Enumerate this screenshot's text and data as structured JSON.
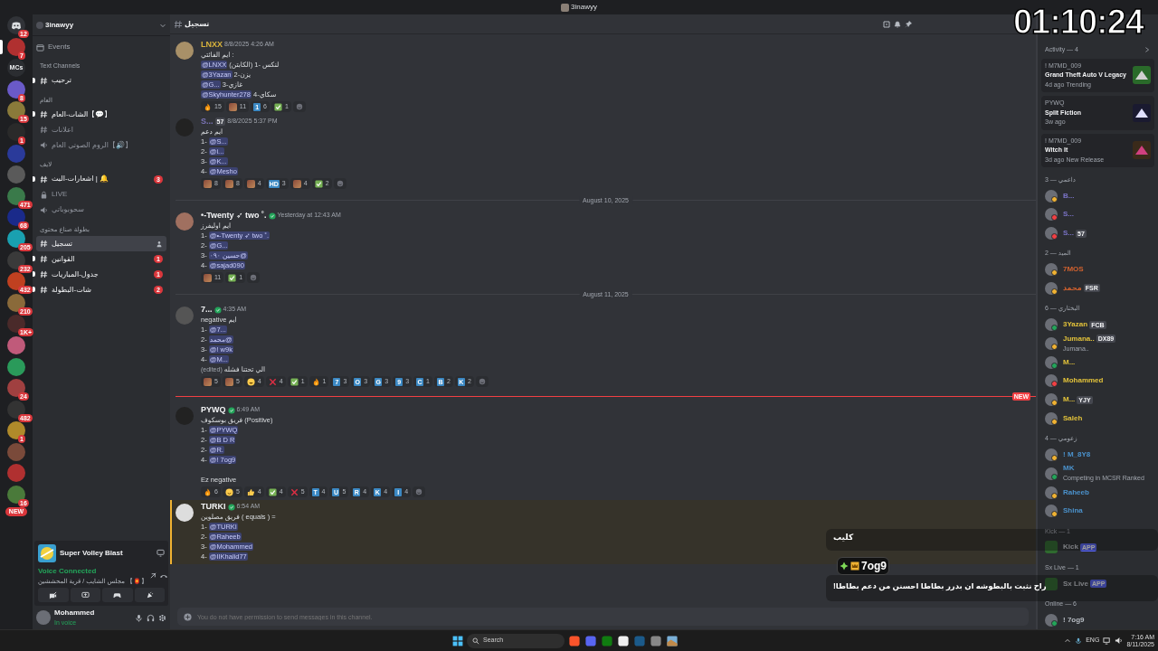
{
  "window": {
    "title": "3inawyy"
  },
  "timer_overlay": "01:10:24",
  "server_rail": [
    {
      "kind": "home",
      "badge": "12",
      "selected": false
    },
    {
      "kind": "server",
      "badge": "7",
      "selected": true
    },
    {
      "kind": "label",
      "label": "MCs",
      "selected": false
    },
    {
      "kind": "server",
      "badge": "8",
      "selected": false
    },
    {
      "kind": "server",
      "badge": "15",
      "selected": false
    },
    {
      "kind": "server",
      "badge": "1",
      "selected": false
    },
    {
      "kind": "server",
      "selected": false
    },
    {
      "kind": "server",
      "selected": false
    },
    {
      "kind": "server",
      "badge": "471",
      "selected": false
    },
    {
      "kind": "server",
      "badge": "68",
      "selected": false
    },
    {
      "kind": "server",
      "badge": "205",
      "selected": false
    },
    {
      "kind": "server",
      "badge": "232",
      "selected": false
    },
    {
      "kind": "server",
      "badge": "432",
      "selected": false
    },
    {
      "kind": "server",
      "badge": "210",
      "selected": false
    },
    {
      "kind": "server",
      "badge": "1K+",
      "selected": false
    },
    {
      "kind": "server",
      "selected": false
    },
    {
      "kind": "server",
      "selected": false
    },
    {
      "kind": "server",
      "badge": "24",
      "selected": false
    },
    {
      "kind": "server",
      "badge": "482",
      "selected": false
    },
    {
      "kind": "server",
      "badge": "1",
      "selected": false
    },
    {
      "kind": "server",
      "selected": false
    },
    {
      "kind": "server",
      "selected": false
    },
    {
      "kind": "server",
      "badge": "16",
      "selected": false
    }
  ],
  "new_pill": "NEW",
  "sidebar": {
    "server_name": "3inawyy",
    "events": "Events",
    "categories": [
      {
        "name": "Text Channels",
        "channels": [
          {
            "kind": "text",
            "name": "ترحيب",
            "unread": true,
            "selected": false
          }
        ]
      },
      {
        "name": "العام",
        "channels": [
          {
            "kind": "text",
            "name": "الشات-العام【💬】",
            "unread": true,
            "selected": false
          },
          {
            "kind": "text",
            "name": "اعلانات",
            "unread": false,
            "selected": false
          },
          {
            "kind": "voice",
            "name": "الروم الصوتي العام【🔊】",
            "unread": false,
            "selected": false
          }
        ]
      },
      {
        "name": "لايف",
        "channels": [
          {
            "kind": "text",
            "name": "اشعارات-البث | 🔔",
            "unread": true,
            "badge": "3",
            "selected": false
          },
          {
            "kind": "locked",
            "name": "LIVE",
            "unread": false,
            "selected": false
          },
          {
            "kind": "voice",
            "name": "سحوبوباتي",
            "unread": false,
            "selected": false
          }
        ]
      },
      {
        "name": "بطولة صناع محتوى",
        "channels": [
          {
            "kind": "text",
            "name": "تسجيل",
            "unread": false,
            "selected": true
          },
          {
            "kind": "text",
            "name": "القوانين",
            "unread": true,
            "badge": "1",
            "selected": false
          },
          {
            "kind": "text",
            "name": "جدول-المباريات",
            "unread": true,
            "badge": "1",
            "selected": false
          },
          {
            "kind": "text",
            "name": "شات-البطولة",
            "unread": true,
            "badge": "2",
            "selected": false
          }
        ]
      }
    ]
  },
  "activity_panel": {
    "game": "Super Volley Blast",
    "voice_status": "Voice Connected",
    "voice_channel": "مجلس الشايب / قرية المحششين 【🏮】"
  },
  "user_panel": {
    "name": "Mohammed",
    "status": "In voice"
  },
  "channel_header": {
    "name": "تسجيل"
  },
  "messages": [
    {
      "kind": "message",
      "author": "LNXX",
      "color": "#d9b43c",
      "time": "8/8/2025 4:26 AM",
      "verified": false,
      "highlighted": false,
      "lines": [
        [
          {
            "kind": "plain",
            "text": "ايم الفائتي :"
          }
        ],
        [
          {
            "kind": "mention",
            "text": "@LNXX"
          },
          {
            "kind": "plain",
            "text": " (الكابتن) لنكس -1"
          }
        ],
        [
          {
            "kind": "mention",
            "text": "@3Yazan"
          },
          {
            "kind": "plain",
            "text": " يزن-2"
          }
        ],
        [
          {
            "kind": "mention",
            "text": "@G..."
          },
          {
            "kind": "plain",
            "text": " غازي-3"
          }
        ],
        [
          {
            "kind": "mention",
            "text": "@Skyhunter278"
          },
          {
            "kind": "plain",
            "text": " سكاي-4"
          }
        ]
      ],
      "reactions": [
        {
          "kind": "fire",
          "count": "15"
        },
        {
          "count": "11"
        },
        {
          "kind": "letter",
          "label": "1",
          "count": "6"
        },
        {
          "kind": "check",
          "count": "1"
        }
      ]
    },
    {
      "kind": "message",
      "author": "S...",
      "color": "#7b74b8",
      "tag": "57",
      "time": "8/8/2025 5:37 PM",
      "verified": false,
      "highlighted": false,
      "lines": [
        [
          {
            "kind": "plain",
            "text": "ايم دعم"
          }
        ],
        [
          {
            "kind": "plain",
            "text": "1- "
          },
          {
            "kind": "mention",
            "text": "@S..."
          }
        ],
        [
          {
            "kind": "plain",
            "text": "2- "
          },
          {
            "kind": "mention",
            "text": "@i..."
          }
        ],
        [
          {
            "kind": "plain",
            "text": "3- "
          },
          {
            "kind": "mention",
            "text": "@K..."
          }
        ],
        [
          {
            "kind": "plain",
            "text": "4- "
          },
          {
            "kind": "mention",
            "text": "@Mesho"
          }
        ]
      ],
      "reactions": [
        {
          "count": "8"
        },
        {
          "count": "8"
        },
        {
          "count": "4"
        },
        {
          "kind": "letter",
          "label": "HD",
          "count": "3"
        },
        {
          "count": "4"
        },
        {
          "kind": "check",
          "count": "2"
        }
      ]
    },
    {
      "kind": "divider",
      "text": "August 10, 2025"
    },
    {
      "kind": "message",
      "author": "•-Twenty ➶ two ˚.",
      "color": "#f2f3f5",
      "time": "Yesterday at 12:43 AM",
      "verified": true,
      "highlighted": false,
      "lines": [
        [
          {
            "kind": "plain",
            "text": "ايم اوليفرز"
          }
        ],
        [
          {
            "kind": "plain",
            "text": "1- "
          },
          {
            "kind": "mention",
            "text": "@•-Twenty ➶ two ˚."
          }
        ],
        [
          {
            "kind": "plain",
            "text": "2- "
          },
          {
            "kind": "mention",
            "text": "@G..."
          }
        ],
        [
          {
            "kind": "plain",
            "text": "3- "
          },
          {
            "kind": "mention",
            "text": "@حسين ٠٩٠"
          }
        ],
        [
          {
            "kind": "plain",
            "text": "4- "
          },
          {
            "kind": "mention",
            "text": "@sajad090"
          }
        ]
      ],
      "reactions": [
        {
          "count": "11"
        },
        {
          "kind": "check",
          "count": "1"
        }
      ]
    },
    {
      "kind": "divider",
      "text": "August 11, 2025"
    },
    {
      "kind": "message",
      "author": "7...",
      "color": "#f2f3f5",
      "time": "4:35 AM",
      "verified": true,
      "highlighted": false,
      "lines": [
        [
          {
            "kind": "plain",
            "text": "negative ايم"
          }
        ],
        [
          {
            "kind": "plain",
            "text": "1- "
          },
          {
            "kind": "mention",
            "text": "@7..."
          }
        ],
        [
          {
            "kind": "plain",
            "text": "2- "
          },
          {
            "kind": "mention",
            "text": "@محمد"
          }
        ],
        [
          {
            "kind": "plain",
            "text": "3- "
          },
          {
            "kind": "mention",
            "text": "@! w9k"
          }
        ],
        [
          {
            "kind": "plain",
            "text": "4- "
          },
          {
            "kind": "mention",
            "text": "@M..."
          }
        ],
        [
          {
            "kind": "edited",
            "text": "(edited)"
          },
          {
            "kind": "plain",
            "text": " الي تحتنا فشله"
          }
        ]
      ],
      "reactions": [
        {
          "count": "5"
        },
        {
          "count": "5"
        },
        {
          "kind": "laugh",
          "count": "4"
        },
        {
          "kind": "cross",
          "count": "4"
        },
        {
          "kind": "check",
          "count": "1"
        },
        {
          "kind": "fire",
          "count": "1"
        },
        {
          "kind": "letter",
          "label": "7",
          "count": "3"
        },
        {
          "kind": "letter",
          "label": "O",
          "count": "3"
        },
        {
          "kind": "letter",
          "label": "G",
          "count": "3"
        },
        {
          "kind": "letter",
          "label": "9",
          "count": "3"
        },
        {
          "kind": "letter",
          "label": "C",
          "count": "1"
        },
        {
          "kind": "letter",
          "label": "B",
          "count": "2"
        },
        {
          "kind": "letter",
          "label": "K",
          "count": "2"
        }
      ]
    },
    {
      "kind": "new_divider",
      "text": "NEW"
    },
    {
      "kind": "message",
      "author": "PYWQ",
      "color": "#f2f3f5",
      "time": "6:49 AM",
      "verified": true,
      "highlighted": false,
      "lines": [
        [
          {
            "kind": "plain",
            "text": "فريق بوسكوف (Positive)"
          }
        ],
        [
          {
            "kind": "plain",
            "text": "1- "
          },
          {
            "kind": "mention",
            "text": "@PYWQ"
          }
        ],
        [
          {
            "kind": "plain",
            "text": "2- "
          },
          {
            "kind": "mention",
            "text": "@B D R"
          }
        ],
        [
          {
            "kind": "plain",
            "text": "2- "
          },
          {
            "kind": "mention",
            "text": "@R."
          }
        ],
        [
          {
            "kind": "plain",
            "text": "4- "
          },
          {
            "kind": "mention",
            "text": "@! 7og9"
          }
        ],
        [
          {
            "kind": "gap"
          },
          {
            "kind": "plain",
            "text": "Ez  negative"
          }
        ]
      ],
      "reactions": [
        {
          "kind": "fire",
          "count": "6"
        },
        {
          "kind": "smile",
          "count": "5"
        },
        {
          "kind": "thumbs",
          "count": "4"
        },
        {
          "kind": "check",
          "count": "4"
        },
        {
          "kind": "cross",
          "count": "5"
        },
        {
          "kind": "letter",
          "label": "T",
          "count": "4"
        },
        {
          "kind": "letter",
          "label": "U",
          "count": "5"
        },
        {
          "kind": "letter",
          "label": "R",
          "count": "4"
        },
        {
          "kind": "letter",
          "label": "K",
          "count": "4"
        },
        {
          "kind": "letter",
          "label": "I",
          "count": "4"
        }
      ]
    },
    {
      "kind": "message",
      "author": "TURKI",
      "color": "#f2f3f5",
      "time": "6:54 AM",
      "verified": true,
      "highlighted": true,
      "lines": [
        [
          {
            "kind": "plain",
            "text": "فريق مصلوين ( equals ) ="
          }
        ],
        [
          {
            "kind": "plain",
            "text": "1- "
          },
          {
            "kind": "mention",
            "text": "@TURKI"
          }
        ],
        [
          {
            "kind": "plain",
            "text": "2- "
          },
          {
            "kind": "mention",
            "text": "@Raheeb"
          }
        ],
        [
          {
            "kind": "plain",
            "text": "3- "
          },
          {
            "kind": "mention",
            "text": "@Mohammed"
          }
        ],
        [
          {
            "kind": "plain",
            "text": "4- "
          },
          {
            "kind": "mention",
            "text": "@IIKhalid77"
          }
        ]
      ]
    }
  ],
  "composer": {
    "placeholder": "You do not have permission to send messages in this channel."
  },
  "activity": {
    "title": "Activity — 4",
    "cards": [
      {
        "user": "! M7MD_009",
        "game": "Grand Theft Auto V Legacy",
        "ago": "4d ago",
        "note": "Trending"
      },
      {
        "user": "PYWQ",
        "game": "Split Fiction",
        "ago": "3w ago"
      },
      {
        "user": "! M7MD_009",
        "game": "Witch It",
        "ago": "3d ago",
        "note": "New Release"
      }
    ]
  },
  "member_groups": [
    {
      "title": "داعمي — 3",
      "color": "#7b74c8",
      "members": [
        {
          "name": "B...",
          "color": "#f0b232"
        },
        {
          "name": "S...",
          "color": "#f23f43"
        },
        {
          "name": "S...",
          "color": "#f23f43",
          "tag": "57"
        }
      ]
    },
    {
      "title": "الميد — 2",
      "color": "#d2622f",
      "members": [
        {
          "name": "7MOS",
          "color": "#f0b232"
        },
        {
          "name": "محمد",
          "color": "#f0b232",
          "tag": "FSR"
        }
      ]
    },
    {
      "title": "البختاري — 6",
      "color": "#e2c23a",
      "members": [
        {
          "name": "3Yazan",
          "color": "#23a55a",
          "tag": "FCB"
        },
        {
          "name": "Jumana..",
          "color": "#f0b232",
          "tag": "DX89",
          "sub": "Jumana.."
        },
        {
          "name": "M...",
          "color": "#23a55a"
        },
        {
          "name": "Mohammed",
          "color": "#f23f43"
        },
        {
          "name": "M...",
          "color": "#f0b232",
          "tag": "YJY"
        },
        {
          "name": "Saleh",
          "color": "#f0b232"
        }
      ]
    },
    {
      "title": "زعومي — 4",
      "color": "#4b92cc",
      "members": [
        {
          "name": "! M_8Y8",
          "color": "#f0b232"
        },
        {
          "name": "MK",
          "color": "#23a55a",
          "sub": "Competing in MCSR Ranked"
        },
        {
          "name": "Raheeb",
          "color": "#f0b232"
        },
        {
          "name": "Shina",
          "color": "#f0b232"
        }
      ]
    },
    {
      "title": "Kick — 1",
      "members": [
        {
          "name": "Kick",
          "app": "APP"
        }
      ]
    },
    {
      "title": "Sx Live — 1",
      "members": [
        {
          "name": "Sx Live",
          "app": "APP"
        }
      ]
    },
    {
      "title": "Online — 6",
      "color": "#b5bac1",
      "members": [
        {
          "name": "! 7og9",
          "color": "#23a55a"
        }
      ]
    }
  ],
  "stream_overlay": {
    "clip_label": "كليب",
    "chatter": "7og9",
    "message": "راح نثبت بالبطوشه ان بدرر بطاطا احسنن من دعم بطاطا!"
  },
  "taskbar": {
    "search": "Search",
    "language": "ENG",
    "time": "7:16 AM",
    "date": "8/11/2025"
  }
}
